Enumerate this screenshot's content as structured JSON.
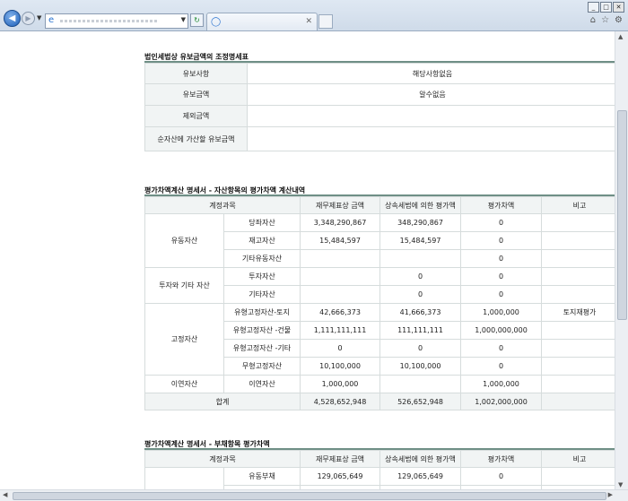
{
  "browser": {
    "window_controls": [
      "_",
      "□",
      "✕"
    ]
  },
  "section1": {
    "title": "법인세법상 유보금액의 조정명세표",
    "rows": [
      {
        "label": "유보사항",
        "value": "해당사항없음"
      },
      {
        "label": "유보금액",
        "value": "알수없음"
      },
      {
        "label": "제외금액",
        "value": ""
      },
      {
        "label": "순자산에 가산할 유보금액",
        "value": ""
      }
    ]
  },
  "section2": {
    "title": "평가차액계산 명세서 - 자산항목의 평가차액 계산내역",
    "headers": [
      "계정과목",
      "재무제표상 금액",
      "상속세법에 의한 평가액",
      "평가차액",
      "비고"
    ],
    "groups": [
      {
        "name": "유동자산",
        "rows": [
          [
            "당좌자산",
            "3,348,290,867",
            "348,290,867",
            "0",
            ""
          ],
          [
            "재고자산",
            "15,484,597",
            "15,484,597",
            "0",
            ""
          ],
          [
            "기타유동자산",
            "",
            "",
            "0",
            ""
          ]
        ]
      },
      {
        "name": "투자와 기타 자산",
        "rows": [
          [
            "투자자산",
            "",
            "0",
            "0",
            ""
          ],
          [
            "기타자산",
            "",
            "0",
            "0",
            ""
          ]
        ]
      },
      {
        "name": "고정자산",
        "rows": [
          [
            "유형고정자산-토지",
            "42,666,373",
            "41,666,373",
            "1,000,000",
            "토지재평가"
          ],
          [
            "유형고정자산 -건물",
            "1,111,111,111",
            "111,111,111",
            "1,000,000,000",
            ""
          ],
          [
            "유형고정자산 -기타",
            "0",
            "0",
            "0",
            ""
          ],
          [
            "무형고정자산",
            "10,100,000",
            "10,100,000",
            "0",
            ""
          ]
        ]
      },
      {
        "name": "이연자산",
        "rows": [
          [
            "이연자산",
            "1,000,000",
            "",
            "1,000,000",
            ""
          ]
        ]
      }
    ],
    "total": {
      "label": "합계",
      "values": [
        "4,528,652,948",
        "526,652,948",
        "1,002,000,000",
        ""
      ]
    }
  },
  "section3": {
    "title": "평가차액계산 명세서 - 부채항목 평가차액",
    "headers": [
      "계정과목",
      "재무제표상 금액",
      "상속세법에 의한 평가액",
      "평가차액",
      "비고"
    ],
    "rows": [
      [
        "유동부채",
        "129,065,649",
        "129,065,649",
        "0",
        ""
      ]
    ]
  }
}
